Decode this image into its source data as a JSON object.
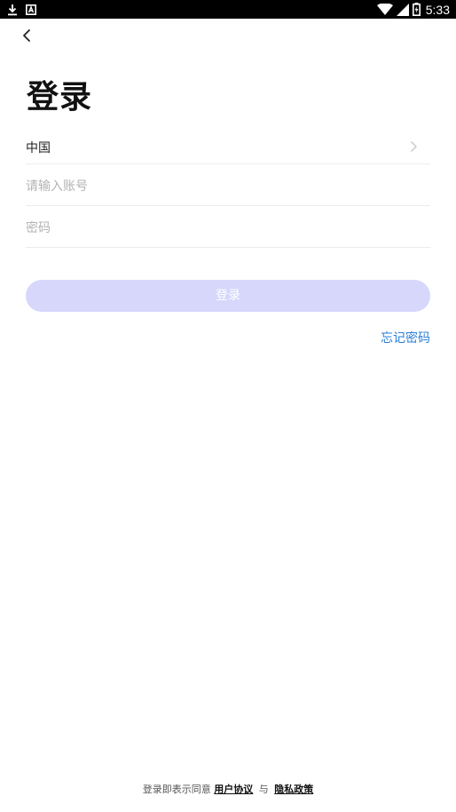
{
  "status_bar": {
    "time": "5:33",
    "left_icons": [
      "download-icon",
      "notification-icon"
    ],
    "right_icons": [
      "wifi-icon",
      "signal-icon",
      "battery-charging-icon"
    ]
  },
  "header": {
    "back_icon": "chevron-left-icon"
  },
  "title": "登录",
  "form": {
    "country_label": "中国",
    "country_chevron_icon": "chevron-right-icon",
    "account_value": "",
    "account_placeholder": "请输入账号",
    "password_value": "",
    "password_placeholder": "密码",
    "login_label": "登录",
    "forgot_label": "忘记密码"
  },
  "footer": {
    "prefix": "登录即表示同意",
    "user_agreement": "用户协议",
    "conjunction": "与",
    "privacy_policy": "隐私政策"
  },
  "colors": {
    "accent": "#2a7fd8",
    "button_disabled": "#d6d7fb",
    "status_bar": "#000000"
  }
}
